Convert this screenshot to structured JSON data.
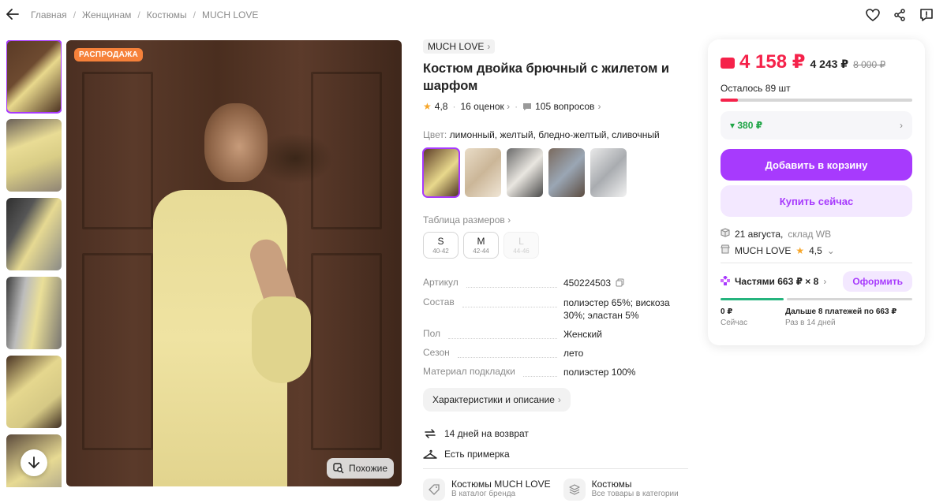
{
  "breadcrumbs": [
    "Главная",
    "Женщинам",
    "Костюмы",
    "MUCH LOVE"
  ],
  "badge": "РАСПРОДАЖА",
  "similar_label": "Похожие",
  "brand": "MUCH LOVE",
  "title": "Костюм двойка брючный с жилетом и шарфом",
  "rating": "4,8",
  "reviews": "16 оценок",
  "questions": "105 вопросов",
  "color_label": "Цвет:",
  "color_value": "лимонный, желтый, бледно-желтый, сливочный",
  "size_table_label": "Таблица размеров",
  "sizes": [
    {
      "label": "S",
      "range": "40-42",
      "available": true
    },
    {
      "label": "M",
      "range": "42-44",
      "available": true
    },
    {
      "label": "L",
      "range": "44-46",
      "available": false
    }
  ],
  "specs": [
    {
      "key": "Артикул",
      "value": "450224503"
    },
    {
      "key": "Состав",
      "value": "полиэстер 65%; вискоза 30%; эластан 5%"
    },
    {
      "key": "Пол",
      "value": "Женский"
    },
    {
      "key": "Сезон",
      "value": "лето"
    },
    {
      "key": "Материал подкладки",
      "value": "полиэстер 100%"
    }
  ],
  "characteristics_button": "Характеристики и описание",
  "perks": [
    "14 дней на возврат",
    "Есть примерка"
  ],
  "links": [
    {
      "title": "Костюмы MUCH LOVE",
      "sub": "В каталог бренда"
    },
    {
      "title": "Костюмы",
      "sub": "Все товары в категории"
    }
  ],
  "price": {
    "main": "4 158 ₽",
    "alt": "4 243 ₽",
    "old": "8 000 ₽",
    "stock_text": "Осталось 89 шт",
    "stock_fraction": 0.09,
    "discount": "▾ 380 ₽",
    "add_to_cart": "Добавить в корзину",
    "buy_now": "Купить сейчас",
    "delivery_date": "21 августа,",
    "warehouse": "склад WB",
    "seller": "MUCH LOVE",
    "seller_rating": "4,5",
    "installments": "Частями 663 ₽ × 8",
    "installments_button": "Оформить",
    "now_amount": "0 ₽",
    "now_label": "Сейчас",
    "next_amount": "Дальше 8 платежей по 663 ₽",
    "next_label": "Раз в 14 дней"
  },
  "colors": {
    "accent": "#a73afd",
    "price": "#f5224a",
    "discount": "#1fa546",
    "badge": "#f6813a"
  }
}
